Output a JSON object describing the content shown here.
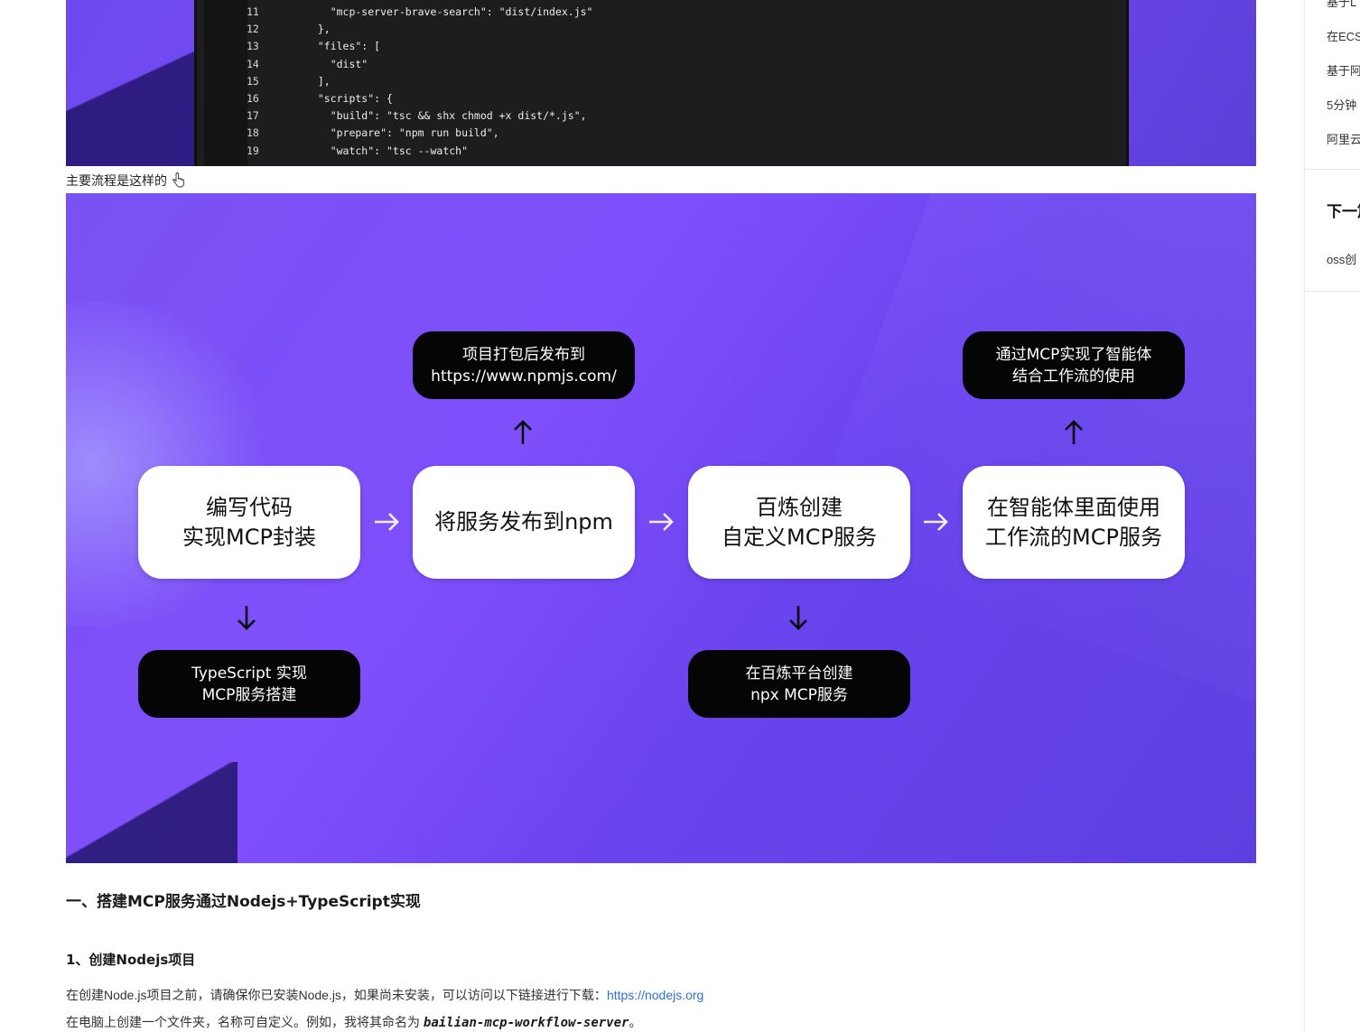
{
  "code_block": {
    "lines": [
      {
        "num": "11",
        "text": "    \"mcp-server-brave-search\": \"dist/index.js\""
      },
      {
        "num": "12",
        "text": "  },"
      },
      {
        "num": "13",
        "text": "  \"files\": ["
      },
      {
        "num": "14",
        "text": "    \"dist\""
      },
      {
        "num": "15",
        "text": "  ],"
      },
      {
        "num": "16",
        "text": "  \"scripts\": {"
      },
      {
        "num": "17",
        "text": "    \"build\": \"tsc && shx chmod +x dist/*.js\","
      },
      {
        "num": "18",
        "text": "    \"prepare\": \"npm run build\","
      },
      {
        "num": "19",
        "text": "    \"watch\": \"tsc --watch\""
      }
    ]
  },
  "caption": "主要流程是这样的",
  "flow": {
    "steps": [
      {
        "label": "编写代码\n实现MCP封装"
      },
      {
        "label": "将服务发布到npm"
      },
      {
        "label": "百炼创建\n自定义MCP服务"
      },
      {
        "label": "在智能体里面使用\n工作流的MCP服务"
      }
    ],
    "notes": {
      "publish": "项目打包后发布到\nhttps://www.npmjs.com/",
      "result": "通过MCP实现了智能体\n结合工作流的使用",
      "typescript": "TypeScript 实现\nMCP服务搭建",
      "bailian": "在百炼平台创建\nnpx MCP服务"
    },
    "colors": {
      "background": "#7b50f6",
      "step_box": "#ffffff",
      "note_box": "#050505"
    }
  },
  "article": {
    "section_heading": "一、搭建MCP服务通过Nodejs+TypeScript实现",
    "sub_heading": "1、创建Nodejs项目",
    "para1_text": "在创建Node.js项目之前，请确保你已安装Node.js，如果尚未安装，可以访问以下链接进行下载：",
    "para1_link": "https://nodejs.org",
    "para2_text": "在电脑上创建一个文件夹，名称可自定义。例如，我将其命名为 ",
    "para2_bold": "bailian-mcp-workflow-server",
    "para2_end": "。"
  },
  "sidebar": {
    "items": [
      "基于L",
      "在ECS",
      "基于阿",
      "5分钟",
      "阿里云"
    ],
    "next_title": "下一篇",
    "next_item": "oss创"
  }
}
